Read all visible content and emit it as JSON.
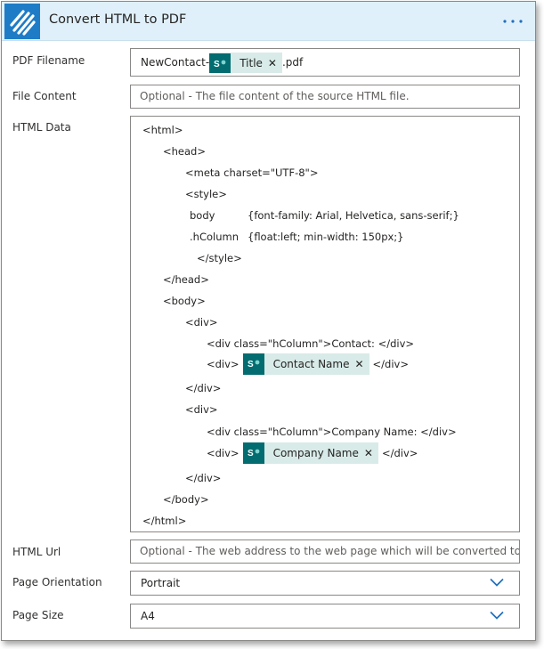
{
  "header": {
    "title": "Convert HTML to PDF"
  },
  "fields": {
    "pdf_filename": {
      "label": "PDF Filename",
      "prefix": "NewContact-",
      "token": "Title",
      "suffix": ".pdf"
    },
    "file_content": {
      "label": "File Content",
      "placeholder": "Optional - The file content of the source HTML file."
    },
    "html_data": {
      "label": "HTML Data",
      "lines": [
        "<html>",
        "<head>",
        "<meta charset=\"UTF-8\">",
        "<style>",
        "body",
        "{font-family: Arial, Helvetica, sans-serif;}",
        ".hColumn",
        "{float:left; min-width: 150px;}",
        "</style>",
        "</head>",
        "<body>",
        "<div>",
        "<div class=\"hColumn\">Contact: </div>",
        "<div>",
        "</div>",
        "</div>",
        "<div>",
        "<div class=\"hColumn\">Company Name: </div>",
        "<div>",
        "</div>",
        "</div>",
        "</body>",
        "</html>"
      ],
      "contact_token": "Contact Name",
      "company_token": "Company Name"
    },
    "html_url": {
      "label": "HTML Url",
      "placeholder": "Optional - The web address to the web page which will be converted to a PDF d"
    },
    "page_orientation": {
      "label": "Page Orientation",
      "value": "Portrait"
    },
    "page_size": {
      "label": "Page Size",
      "value": "A4"
    }
  },
  "icons": {
    "app": "striped-logo-icon",
    "menu": "more-dots-icon",
    "token": "sharepoint-icon",
    "remove": "close-icon",
    "dropdown": "chevron-down-icon"
  },
  "colors": {
    "header_bg": "#dff0fb",
    "app_icon": "#1e7cc7",
    "token_bg": "#d8ebe8",
    "sharepoint": "#036c70",
    "chevron": "#1e6fc0"
  }
}
